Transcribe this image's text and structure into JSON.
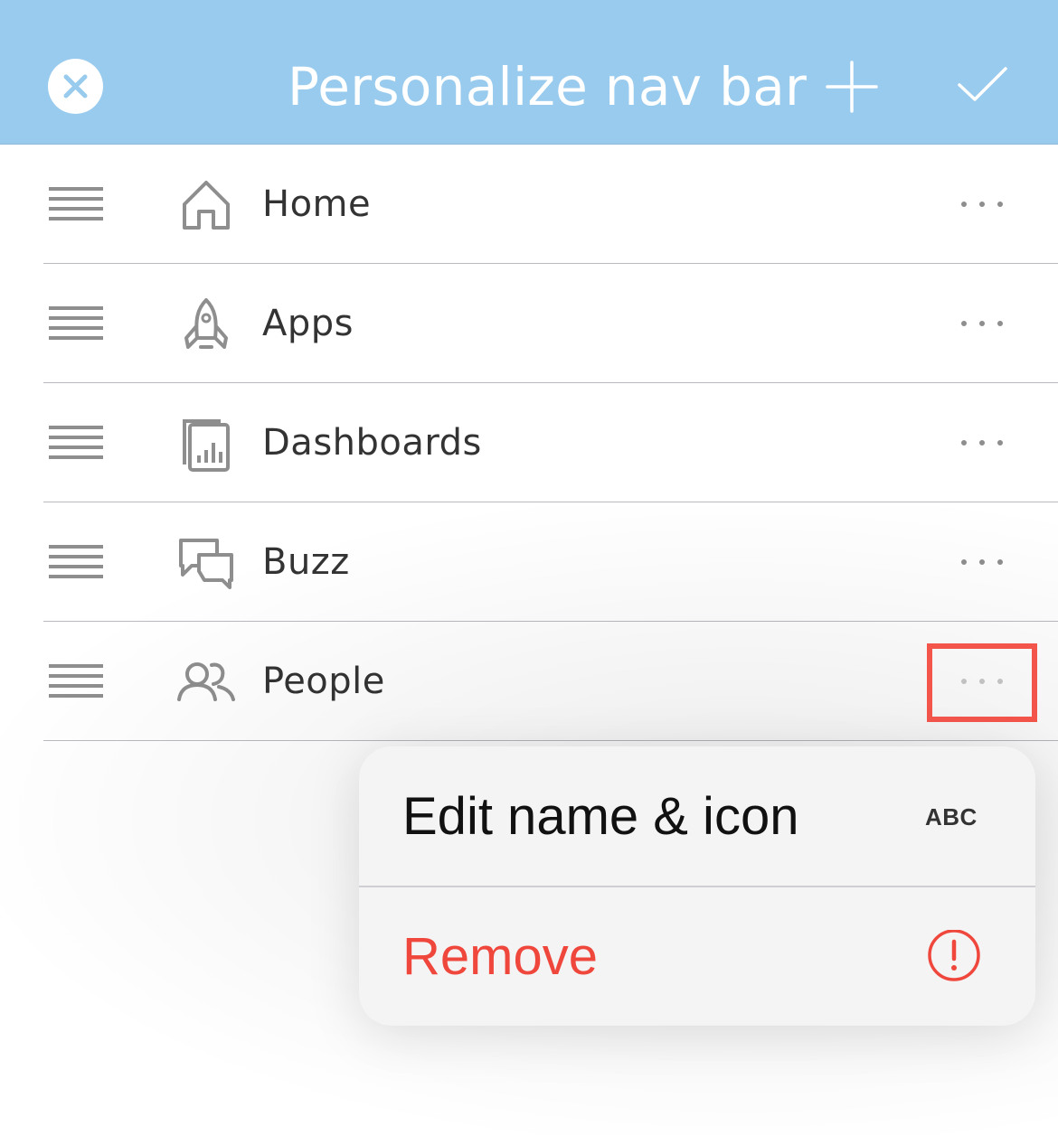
{
  "header": {
    "title": "Personalize nav bar",
    "close_icon": "close-icon",
    "add_icon": "plus-icon",
    "done_icon": "checkmark-icon",
    "background": "#99cbee"
  },
  "nav_items": [
    {
      "label": "Home",
      "icon": "home-icon"
    },
    {
      "label": "Apps",
      "icon": "rocket-icon"
    },
    {
      "label": "Dashboards",
      "icon": "dashboard-icon"
    },
    {
      "label": "Buzz",
      "icon": "chat-bubbles-icon"
    },
    {
      "label": "People",
      "icon": "people-icon"
    }
  ],
  "context_menu": {
    "edit": {
      "label": "Edit name & icon",
      "icon_text": "ABC"
    },
    "remove": {
      "label": "Remove",
      "icon": "exclamation-circle-icon",
      "color": "#f0473d"
    }
  },
  "highlight_color": "#f3554b"
}
